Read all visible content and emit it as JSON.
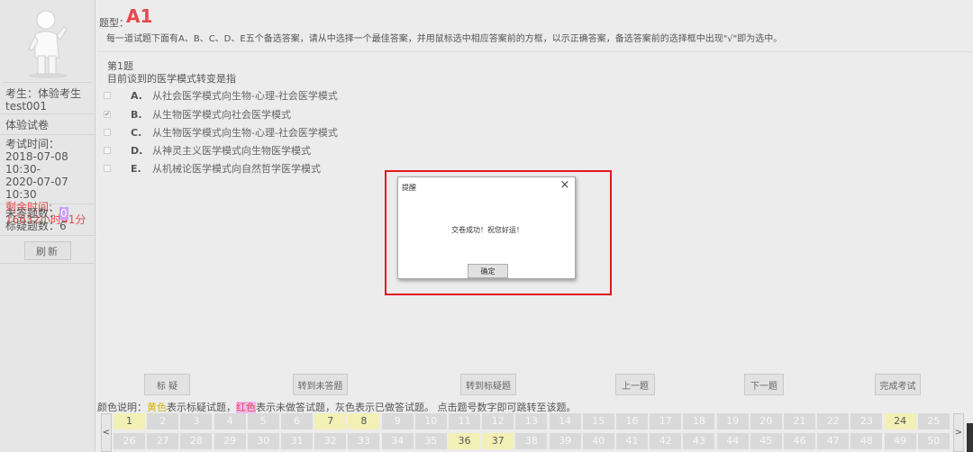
{
  "sidebar": {
    "examinee_line1": "考生：体验考生",
    "examinee_line2": "test001",
    "paper_name": "体验试卷",
    "time_label": "考试时间：",
    "time_start": "2018-07-08 10:30-",
    "time_end": "2020-07-07 10:30",
    "remaining_label": "剩余时间:",
    "remaining_value": "16632小时41分",
    "unanswered_label": "未答题数：",
    "unanswered_count": "0",
    "flagged_label": "标疑题数：",
    "flagged_count": "6",
    "refresh_label": "刷新"
  },
  "main": {
    "qtype_label": "题型：",
    "qtype_value": "A1",
    "instruction": "每一道试题下面有A、B、C、D、E五个备选答案，请从中选择一个最佳答案，并用鼠标选中相应答案前的方框，以示正确答案，备选答案前的选择框中出现\"√\"即为选中。",
    "question_number": "第1题",
    "question_text": "目前谈到的医学模式转变是指",
    "options": [
      {
        "letter": "A.",
        "text": "从社会医学模式向生物-心理-社会医学模式",
        "checked": false
      },
      {
        "letter": "B.",
        "text": "从生物医学模式向社会医学模式",
        "checked": true
      },
      {
        "letter": "C.",
        "text": "从生物医学模式向生物-心理-社会医学模式",
        "checked": false
      },
      {
        "letter": "D.",
        "text": "从神灵主义医学模式向生物医学模式",
        "checked": false
      },
      {
        "letter": "E.",
        "text": "从机械论医学模式向自然哲学医学模式",
        "checked": false
      }
    ]
  },
  "nav": {
    "flag": "标 疑",
    "to_unanswered": "转到未答题",
    "to_flagged": "转到标疑题",
    "prev": "上一题",
    "next": "下一题",
    "finish": "完成考试",
    "prev_arrow": "<",
    "next_arrow": ">"
  },
  "legend": {
    "prefix": "颜色说明：",
    "yellow": "黄色",
    "yellow_desc": "表示标疑试题，",
    "red": "红色",
    "red_desc": "表示未做答试题，灰色表示已做答试题。 点击题号数字即可跳转至该题。"
  },
  "question_grid": {
    "row1": [
      "1",
      "2",
      "3",
      "4",
      "5",
      "6",
      "7",
      "8",
      "9",
      "10",
      "11",
      "12",
      "13",
      "14",
      "15",
      "16",
      "17",
      "18",
      "19",
      "20",
      "21",
      "22",
      "23",
      "24",
      "25"
    ],
    "row2": [
      "26",
      "27",
      "28",
      "29",
      "30",
      "31",
      "32",
      "33",
      "34",
      "35",
      "36",
      "37",
      "38",
      "39",
      "40",
      "41",
      "42",
      "43",
      "44",
      "45",
      "46",
      "47",
      "48",
      "49",
      "50"
    ],
    "flagged": [
      "1",
      "7",
      "8",
      "24",
      "36",
      "37"
    ]
  },
  "dialog": {
    "title": "提醒",
    "close": "×",
    "message": "交卷成功！祝您好运！",
    "ok": "确定"
  },
  "colors": {
    "accent_red": "#e8484b",
    "flag_yellow": "#f3f0b6",
    "highlight_frame": "#e0191e"
  }
}
